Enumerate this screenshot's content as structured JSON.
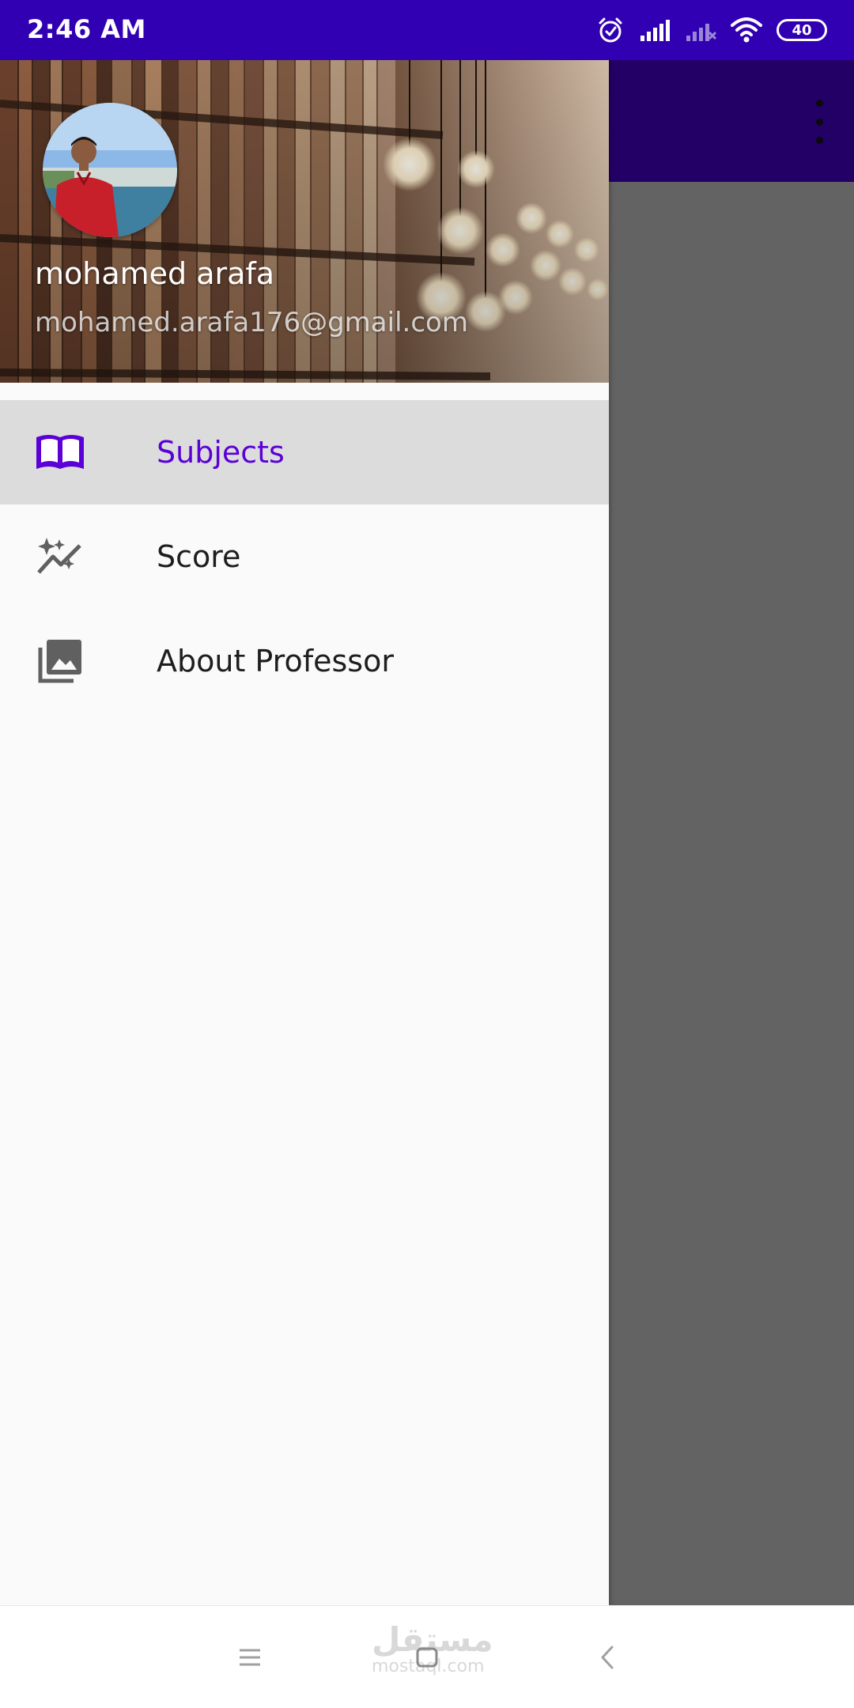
{
  "status_bar": {
    "time": "2:46 AM",
    "battery": "40",
    "icons": [
      "alarm-icon",
      "signal-icon",
      "signal-no-service-icon",
      "wifi-icon",
      "battery-icon"
    ]
  },
  "app_bar": {
    "background": "#230065",
    "overflow_icon": "more-vertical-icon"
  },
  "drawer": {
    "header": {
      "user_name": "mohamed arafa",
      "user_email": "mohamed.arafa176@gmail.com"
    },
    "items": [
      {
        "label": "Subjects",
        "icon": "book-open-icon",
        "selected": true
      },
      {
        "label": "Score",
        "icon": "auto-graph-icon",
        "selected": false
      },
      {
        "label": "About Professor",
        "icon": "photo-library-icon",
        "selected": false
      }
    ]
  },
  "nav_bar": {
    "watermark_arabic": "مستقل",
    "watermark_latin": "mostaql.com",
    "buttons": [
      "menu-icon",
      "home-icon",
      "back-icon"
    ]
  },
  "colors": {
    "status_bar": "#3200b3",
    "accent": "#5b00d6",
    "selected_row": "#dcdcdc",
    "scrim": "#636363"
  }
}
